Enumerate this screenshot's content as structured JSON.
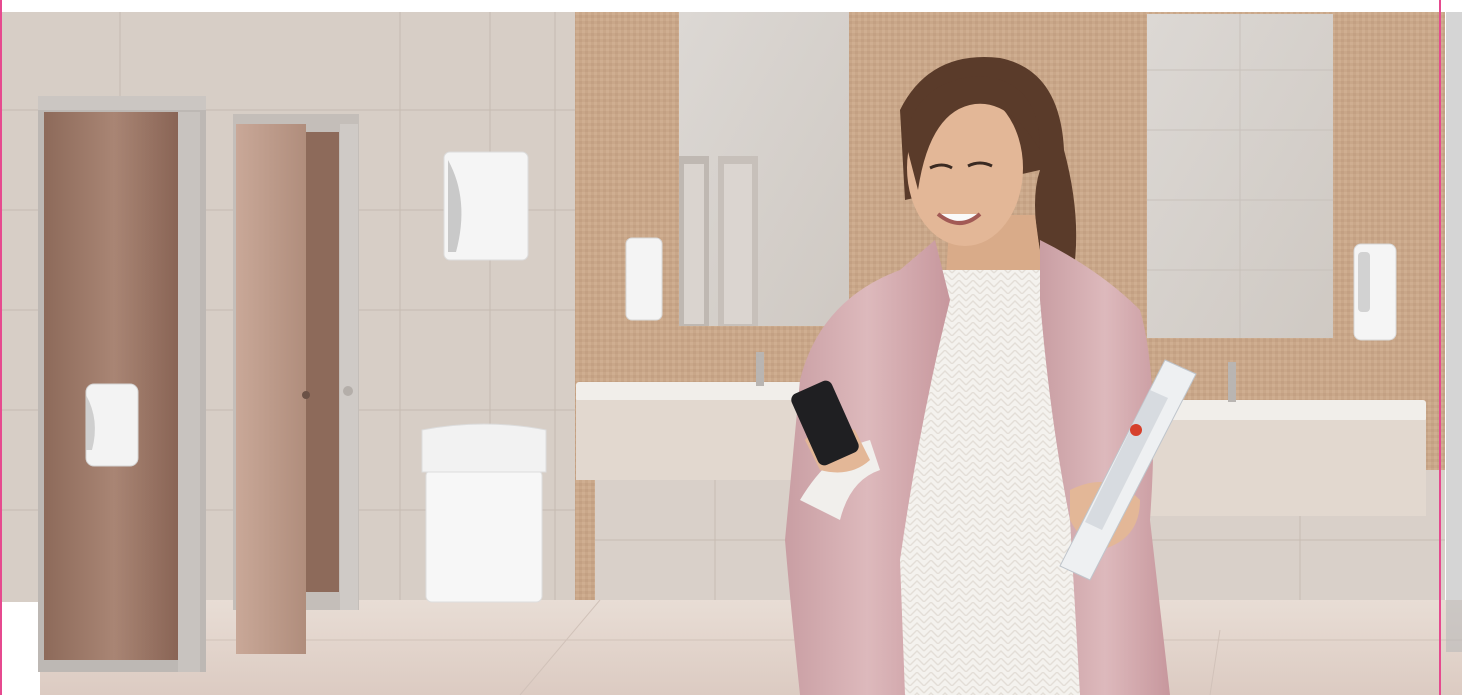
{
  "scene": {
    "description_tag": "photo",
    "colors": {
      "wall_tile": "#d6cdc4",
      "wall_mosaic": "#c9a789",
      "floor": "#e3d6cf",
      "door_bronze": "#9a7766",
      "chrome": "#b9b5b2",
      "dispenser_white": "#f2f2f2",
      "vanity_wood": "#e6ddd4",
      "coat_pink": "#d8b3b6",
      "sweater_white": "#f4f2ee",
      "hair_brown": "#5a3b2a",
      "skin": "#e0b392",
      "phone_black": "#1f1f22",
      "frame_pink": "#e64a8f"
    },
    "objects": [
      {
        "name": "restroom-background"
      },
      {
        "name": "stall-door-left"
      },
      {
        "name": "stall-door-right"
      },
      {
        "name": "toilet-paper-dispenser"
      },
      {
        "name": "paper-towel-dispenser"
      },
      {
        "name": "waste-bin"
      },
      {
        "name": "mirror-left"
      },
      {
        "name": "mirror-right"
      },
      {
        "name": "soap-dispenser-left"
      },
      {
        "name": "soap-dispenser-right"
      },
      {
        "name": "vanity-left"
      },
      {
        "name": "vanity-right"
      },
      {
        "name": "woman"
      },
      {
        "name": "smartphone"
      },
      {
        "name": "magazine-binder"
      }
    ]
  }
}
